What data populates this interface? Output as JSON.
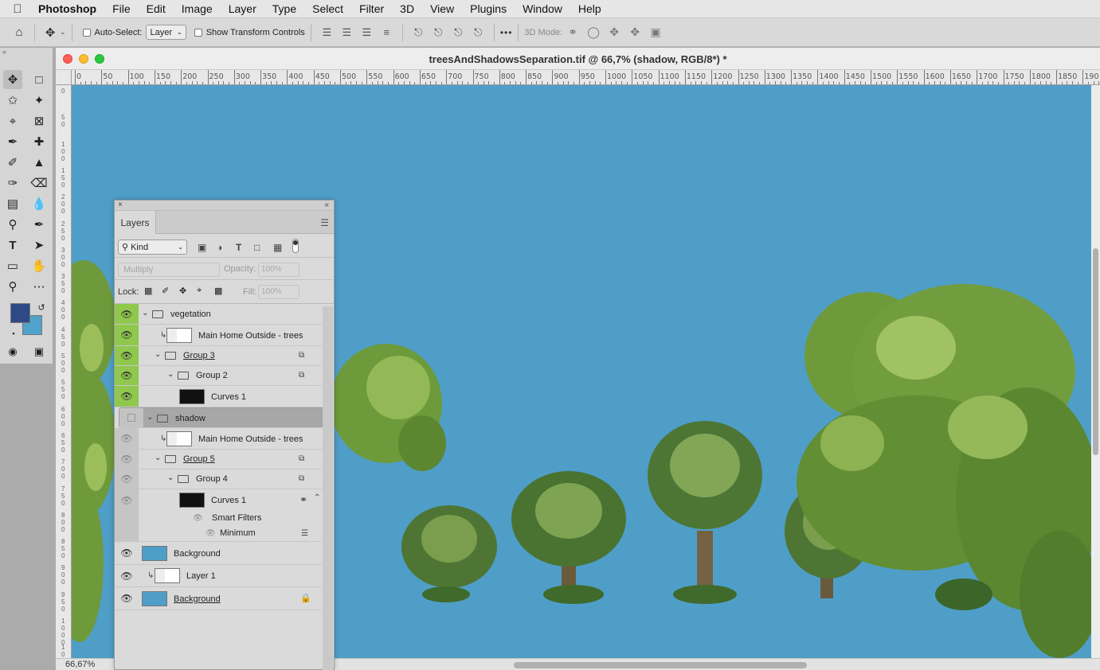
{
  "menubar": {
    "apple": "",
    "items": [
      "Photoshop",
      "File",
      "Edit",
      "Image",
      "Layer",
      "Type",
      "Select",
      "Filter",
      "3D",
      "View",
      "Plugins",
      "Window",
      "Help"
    ]
  },
  "options": {
    "auto_select_label": "Auto-Select:",
    "auto_select_value": "Layer",
    "show_transform_label": "Show Transform Controls",
    "mode_label": "3D Mode:",
    "more": "•••"
  },
  "document": {
    "title": "treesAndShadowsSeparation.tif @ 66,7% (shadow, RGB/8*) *",
    "zoom": "66,67%",
    "ruler_labels": [
      "0",
      "50",
      "100",
      "150",
      "200",
      "250",
      "300",
      "350",
      "400",
      "450",
      "500",
      "550",
      "600",
      "650",
      "700",
      "750",
      "800",
      "850",
      "900",
      "950",
      "1000",
      "1050",
      "1100",
      "1150",
      "1200",
      "1250",
      "1300",
      "1350",
      "1400",
      "1450",
      "1500",
      "1550",
      "1600",
      "1650",
      "1700",
      "1750",
      "1800",
      "1850",
      "190"
    ],
    "canvas_color": "#4f9ec8"
  },
  "layers_panel": {
    "tab": "Layers",
    "kind": "Kind",
    "blend_mode": "Multiply",
    "opacity_label": "Opacity:",
    "opacity_value": "100%",
    "lock_label": "Lock:",
    "fill_label": "Fill:",
    "fill_value": "100%",
    "layers": [
      {
        "name": "vegetation"
      },
      {
        "name": "Main Home Outside - trees"
      },
      {
        "name": "Group 3"
      },
      {
        "name": "Group 2"
      },
      {
        "name": "Curves 1"
      },
      {
        "name": "shadow"
      },
      {
        "name": "Main Home Outside - trees"
      },
      {
        "name": "Group 5"
      },
      {
        "name": "Group 4"
      },
      {
        "name": "Curves 1"
      },
      {
        "name": "Smart Filters"
      },
      {
        "name": "Minimum"
      },
      {
        "name": "Background"
      },
      {
        "name": "Layer 1"
      },
      {
        "name": "Background"
      }
    ]
  },
  "colors": {
    "foreground": "#2e4a86",
    "background": "#4fa3cc",
    "group_eye_green": "#90c84e"
  }
}
